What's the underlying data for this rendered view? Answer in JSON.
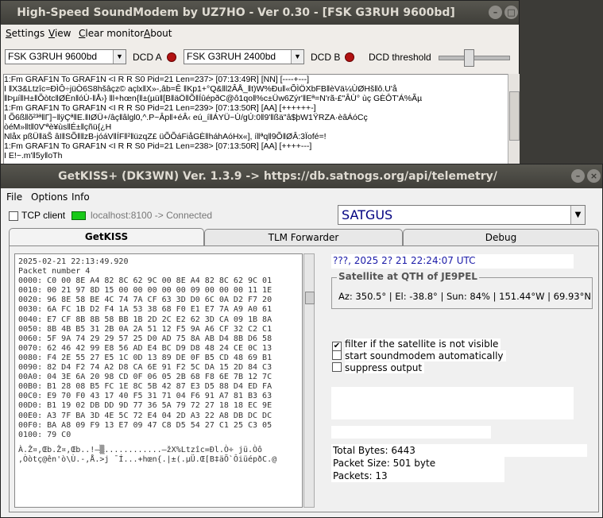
{
  "soundmodem": {
    "title": "High-Speed SoundModem by UZ7HO - Ver 0.30 - [FSK G3RUH 9600bd]",
    "menu": [
      "Settings",
      "View",
      "Clear monitor",
      "About"
    ],
    "modem_a": "FSK G3RUH 9600bd",
    "dcd_a_label": "DCD A",
    "modem_b": "FSK G3RUH 2400bd",
    "dcd_b_label": "DCD B",
    "dcd_threshold_label": "DCD threshold",
    "monitor_lines": [
      "1:Fm GRAF1N To GRAF1N <I R R S0 Pid=21 Len=237> [07:13:49R] [NN] [----+---]",
      "I         ‖X3&Ltzîc=ÐÌÔ÷jüÒ6S8hšâçz© açlx‖X»-,âb=Ê       ‖Kp1+°Q&‖l2ÂÅ_‖t)W%Ðu‖«ÕÌÖXbFB‖èVä¼ÙØHš‖ô.U'å",
      "‖Þµí‖H±‖Õòtc‖ØÈn‖óÙ-‖Å›} ‖l+hœn{‖±(µü‖[B‖äÖ‖Õ‖ÍûépðC@ô1qo‖%c±Üw6Zýr'‖Eª=N'rã-£\"ÂÙ°       ùç       GÈÔT'Á%Ãµ",
      "1:Fm GRAF1N To GRAF1N <I R R S0 Pid=21 Len=239> [07:13:50R] [AA] [++++++-]",
      "I          Õ6ß‖õ²³ª‖Γ]~‖ÿÇª‖Ε.‖ΙØÜ+/âç‖âlgl0,^.P~Âp‖+éÂ‹ eú_í‖ÁYÜ~Ù/gÚ:0‖9'‖ßä\"â$þW1ŸRZA·èâÁóCç",
      "òéM»‖t‖0V'ªè¥ùs‖É±‖çñü{¿H",
      "Nlåx        pßÜ‖äŠ âI‖SÕ‖‖zB-jóáV‖ÍF‖²‖üzqZ£ üÕÕáFiåGÈ‖háhAóHx«],                 í‖ªq‖9Õ‖ØÂ:3Ïofé=!",
      "1:Fm GRAF1N To GRAF1N <I R R S0 Pid=21 Len=238> [07:13:50R] [AA] [++++---]",
      "I          E!~.m'‖5y‖oTh"
    ]
  },
  "getkiss": {
    "title": "GetKISS+ (DK3WN) Ver. 1.3.9 -> https://db.satnogs.org/api/telemetry/",
    "menu": [
      "File",
      "Options",
      "Info"
    ],
    "tcp_client_label": "TCP client",
    "connection_status": "localhost:8100 -> Connected",
    "satellite": "SATGUS",
    "tabs": [
      "GetKISS",
      "TLM Forwarder",
      "Debug"
    ],
    "packet_header": [
      "2025-02-21 22:13:49.920",
      "Packet number 4"
    ],
    "hex_lines": [
      "0000: C0 00 8E A4 82 8C 62 9C 00 8E A4 82 8C 62 9C 01",
      "0010: 00 21 97 8D 15 00 00 00 00 00 09 00 00 00 11 1E",
      "0020: 96 8E 58 BE 4C 74 7A CF 63 3D D0 6C 0A D2 F7 20",
      "0030: 6A FC 1B D2 F4 1A 53 38 68 F0 E1 E7 7A A9 A0 61",
      "0040: E7 CF 8B 8B 58 BB 1B 2D 2C E2 62 3D CA 09 1B 8A",
      "0050: 8B 4B B5 31 2B 0A 2A 51 12 F5 9A A6 CF 32 C2 C1",
      "0060: 5F 9A 74 29 29 57 25 D0 AD 75 8A AB D4 8B D6 58",
      "0070: 62 46 42 99 E8 56 AD E4 BC D9 D8 48 24 CE 0C 13",
      "0080: F4 2E 55 27 E5 1C 0D 13 89 DE 0F B5 CD 48 69 B1",
      "0090: 82 D4 F2 74 A2 D8 CA 6E 91 F2 5C DA 15 2D 84 C3",
      "00A0: 04 3E 6A 20 98 CD 0F 06 05 2B 68 F8 6E 7B 12 7C",
      "00B0: B1 28 08 B5 FC 1E 8C 5B 42 87 E3 D5 88 D4 ED FA",
      "00C0: E9 70 F0 43 17 40 F5 31 71 04 F6 91 A7 81 B3 63",
      "00D0: B1 19 02 DB DD 9D 77 36 5A 79 72 27 18 18 EC 9E",
      "00E0: A3 7F BA 3D 4E 5C 72 E4 04 2D A3 22 A8 DB DC DC",
      "00F0: BA A8 09 F9 13 E7 09 47 C8 D5 54 27 C1 25 C3 05",
      "0100: 79 C0"
    ],
    "ascii_lines": [
      "À.Ž¤‚Œb.Ž¤‚Œb..!—▒............—žX%Ltzîc=Ðl.Ò÷ jü.Òô",
      ",Òòtç@ên'ò\\Ù.-‚Å.>j ¯Í...+hœn{.|±(.µÜ.Œ[B‡äÕ`ÔiüépðC.@"
    ],
    "datetime_line": "???, 2025 2? 21  22:24:07 UTC",
    "qth_title": "Satellite at QTH of JE9PEL",
    "qth_value": "Az: 350.5° | El: -38.8° | Sun: 84% | 151.44°W | 69.93°N",
    "options": [
      {
        "label": "filter if the satellite is not visible",
        "checked": true
      },
      {
        "label": "start soundmodem automatically",
        "checked": false
      },
      {
        "label": "suppress output",
        "checked": false
      }
    ],
    "stats": [
      "Total Bytes: 6443",
      "Packet Size: 501 byte",
      "Packets: 13"
    ],
    "colors": {
      "connected_led": "#19c919",
      "dcd_led": "#b21212",
      "title_bar": "#4a4943"
    }
  }
}
